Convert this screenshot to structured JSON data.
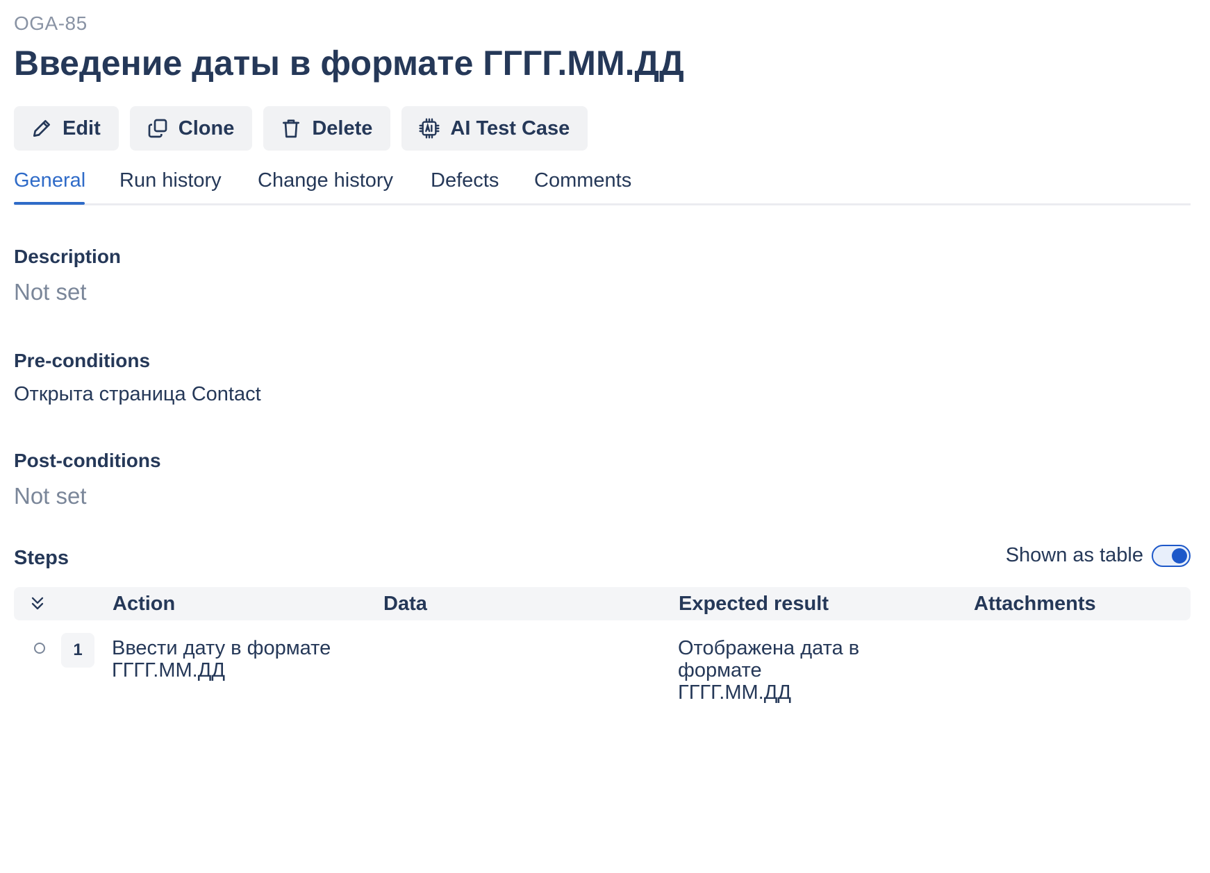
{
  "issue": {
    "key": "OGA-85",
    "title": "Введение даты в формате ГГГГ.ММ.ДД"
  },
  "toolbar": {
    "edit_label": "Edit",
    "clone_label": "Clone",
    "delete_label": "Delete",
    "ai_label": "AI Test Case",
    "icons": [
      "pencil-icon",
      "copy-icon",
      "trash-icon",
      "ai-chip-icon"
    ]
  },
  "tabs": [
    {
      "label": "General",
      "active": true
    },
    {
      "label": "Run history",
      "active": false
    },
    {
      "label": "Change history",
      "active": false
    },
    {
      "label": "Defects",
      "active": false
    },
    {
      "label": "Comments",
      "active": false
    }
  ],
  "sections": {
    "description": {
      "label": "Description",
      "value": "Not set"
    },
    "preconditions": {
      "label": "Pre-conditions",
      "value": "Открыта страница Contact"
    },
    "postconditions": {
      "label": "Post-conditions",
      "value": "Not set"
    }
  },
  "steps": {
    "label": "Steps",
    "toggle_label": "Shown as table",
    "toggle_on": true,
    "columns": [
      "Action",
      "Data",
      "Expected result",
      "Attachments"
    ],
    "rows": [
      {
        "number": "1",
        "action_line1": "Ввести дату в формате",
        "action_line2": "ГГГГ.ММ.ДД",
        "data": "",
        "expected_line1": "Отображена дата в формате",
        "expected_line2": "ГГГГ.ММ.ДД",
        "attachments": ""
      }
    ]
  },
  "colors": {
    "accent": "#2f6bc8",
    "toggle": "#1d58c9",
    "text": "#253858",
    "muted": "#7a8699",
    "button_bg": "#f1f2f4"
  }
}
